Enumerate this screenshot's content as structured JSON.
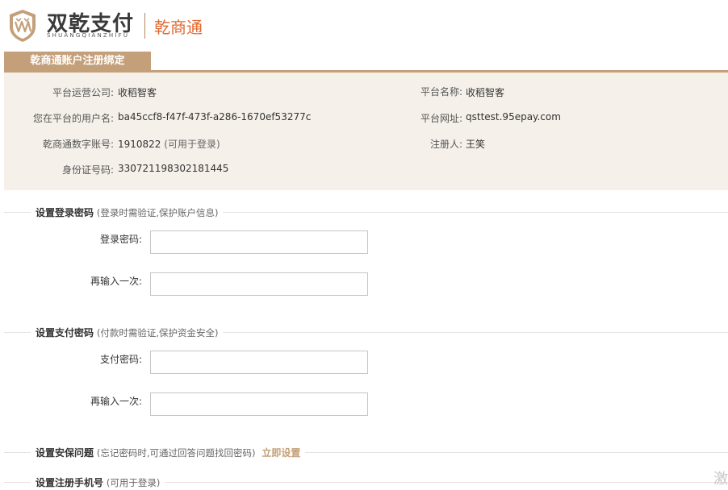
{
  "header": {
    "brand_cn": "双乾支付",
    "brand_en": "SHUANGQIANZHIFU",
    "product_name": "乾商通"
  },
  "tab": {
    "label": "乾商通账户注册绑定"
  },
  "info": {
    "operator": {
      "label": "平台运营公司:",
      "value": "收稻智客"
    },
    "platform_name": {
      "label": "平台名称:",
      "value": "收稻智客"
    },
    "username": {
      "label": "您在平台的用户名:",
      "value": "ba45ccf8-f47f-473f-a286-1670ef53277c"
    },
    "platform_url": {
      "label": "平台网址:",
      "value": "qsttest.95epay.com"
    },
    "digital_account": {
      "label": "乾商通数字账号:",
      "value": "1910822",
      "hint": "(可用于登录)"
    },
    "registrant": {
      "label": "注册人:",
      "value": "王笑"
    },
    "id_number": {
      "label": "身份证号码:",
      "value": "330721198302181445"
    }
  },
  "sections": {
    "login_password": {
      "title": "设置登录密码",
      "hint": "(登录时需验证,保护账户信息)",
      "password_label": "登录密码:",
      "confirm_label": "再输入一次:"
    },
    "pay_password": {
      "title": "设置支付密码",
      "hint": "(付款时需验证,保护资金安全)",
      "password_label": "支付密码:",
      "confirm_label": "再输入一次:"
    },
    "security_question": {
      "title": "设置安保问题",
      "hint": "(忘记密码时,可通过回答问题找回密码)",
      "link": "立即设置"
    },
    "phone": {
      "title": "设置注册手机号",
      "hint": "(可用于登录)"
    }
  },
  "corner_text": "激",
  "colors": {
    "accent": "#c4a07a",
    "brand_orange": "#e2672f",
    "panel_bg": "#f5f0ea"
  }
}
